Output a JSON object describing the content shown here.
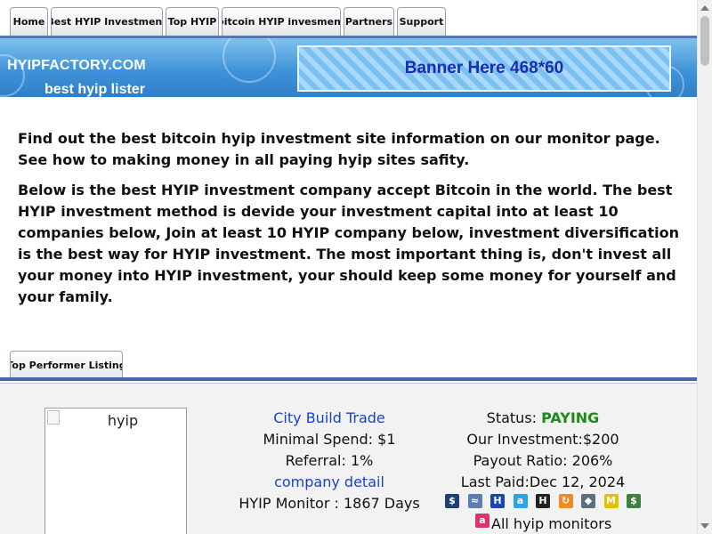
{
  "nav": {
    "tabs": [
      {
        "label": "Home"
      },
      {
        "label": "Best HYIP Investment"
      },
      {
        "label": "Top HYIP"
      },
      {
        "label": "bitcoin HYIP invesment"
      },
      {
        "label": "Partners"
      },
      {
        "label": "Support"
      }
    ]
  },
  "banner": {
    "site_name": "HYIPFACTORY.COM",
    "tagline": "best hyip lister",
    "ad_text": "Banner Here 468*60"
  },
  "intro": {
    "p1": "Find out the best bitcoin hyip investment site information on our monitor page. See how to making money in all paying hyip sites safity.",
    "p2": "Below is the best HYIP investment company accept Bitcoin in the world. The best HYIP investment method is devide your investment capital into at least 10 companies below, Join at least 10 HYIP company below, investment diversification is the best way for HYIP investment. The most important thing is, don't invest all your money into HYIP investment, your should keep some money for yourself and your family."
  },
  "listing": {
    "tab_label": "Top Performer Listing",
    "items": [
      {
        "image_alt": "hyip",
        "name": "City Build Trade",
        "minimal_spend": "Minimal Spend: $1",
        "referral": "Referral: 1%",
        "detail_link": "company detail",
        "monitor_days": "HYIP Monitor : 1867 Days",
        "status_label": "Status: ",
        "status_value": "PAYING",
        "our_investment": "Our Investment:$200",
        "payout_ratio": "Payout Ratio: 206%",
        "last_paid": "Last Paid:Dec 12, 2024",
        "all_monitors": "All hyip monitors",
        "monitor_icons": [
          {
            "icon": "dollar-icon",
            "glyph": "$",
            "color": "#1d3f73"
          },
          {
            "icon": "chart-icon",
            "glyph": "≈",
            "color": "#5b7fb3"
          },
          {
            "icon": "h-icon",
            "glyph": "H",
            "color": "#1646b4"
          },
          {
            "icon": "a-icon",
            "glyph": "a",
            "color": "#29a5e3"
          },
          {
            "icon": "h-dark-icon",
            "glyph": "H",
            "color": "#222222"
          },
          {
            "icon": "refresh-icon",
            "glyph": "↻",
            "color": "#f08a24"
          },
          {
            "icon": "diamond-icon",
            "glyph": "◆",
            "color": "#5e6e80"
          },
          {
            "icon": "m-icon",
            "glyph": "M",
            "color": "#e0c200"
          },
          {
            "icon": "cash-icon",
            "glyph": "$",
            "color": "#3f7f3f"
          }
        ],
        "extra_icon": {
          "icon": "a-pink-icon",
          "glyph": "a",
          "color": "#e0306e"
        }
      }
    ]
  }
}
